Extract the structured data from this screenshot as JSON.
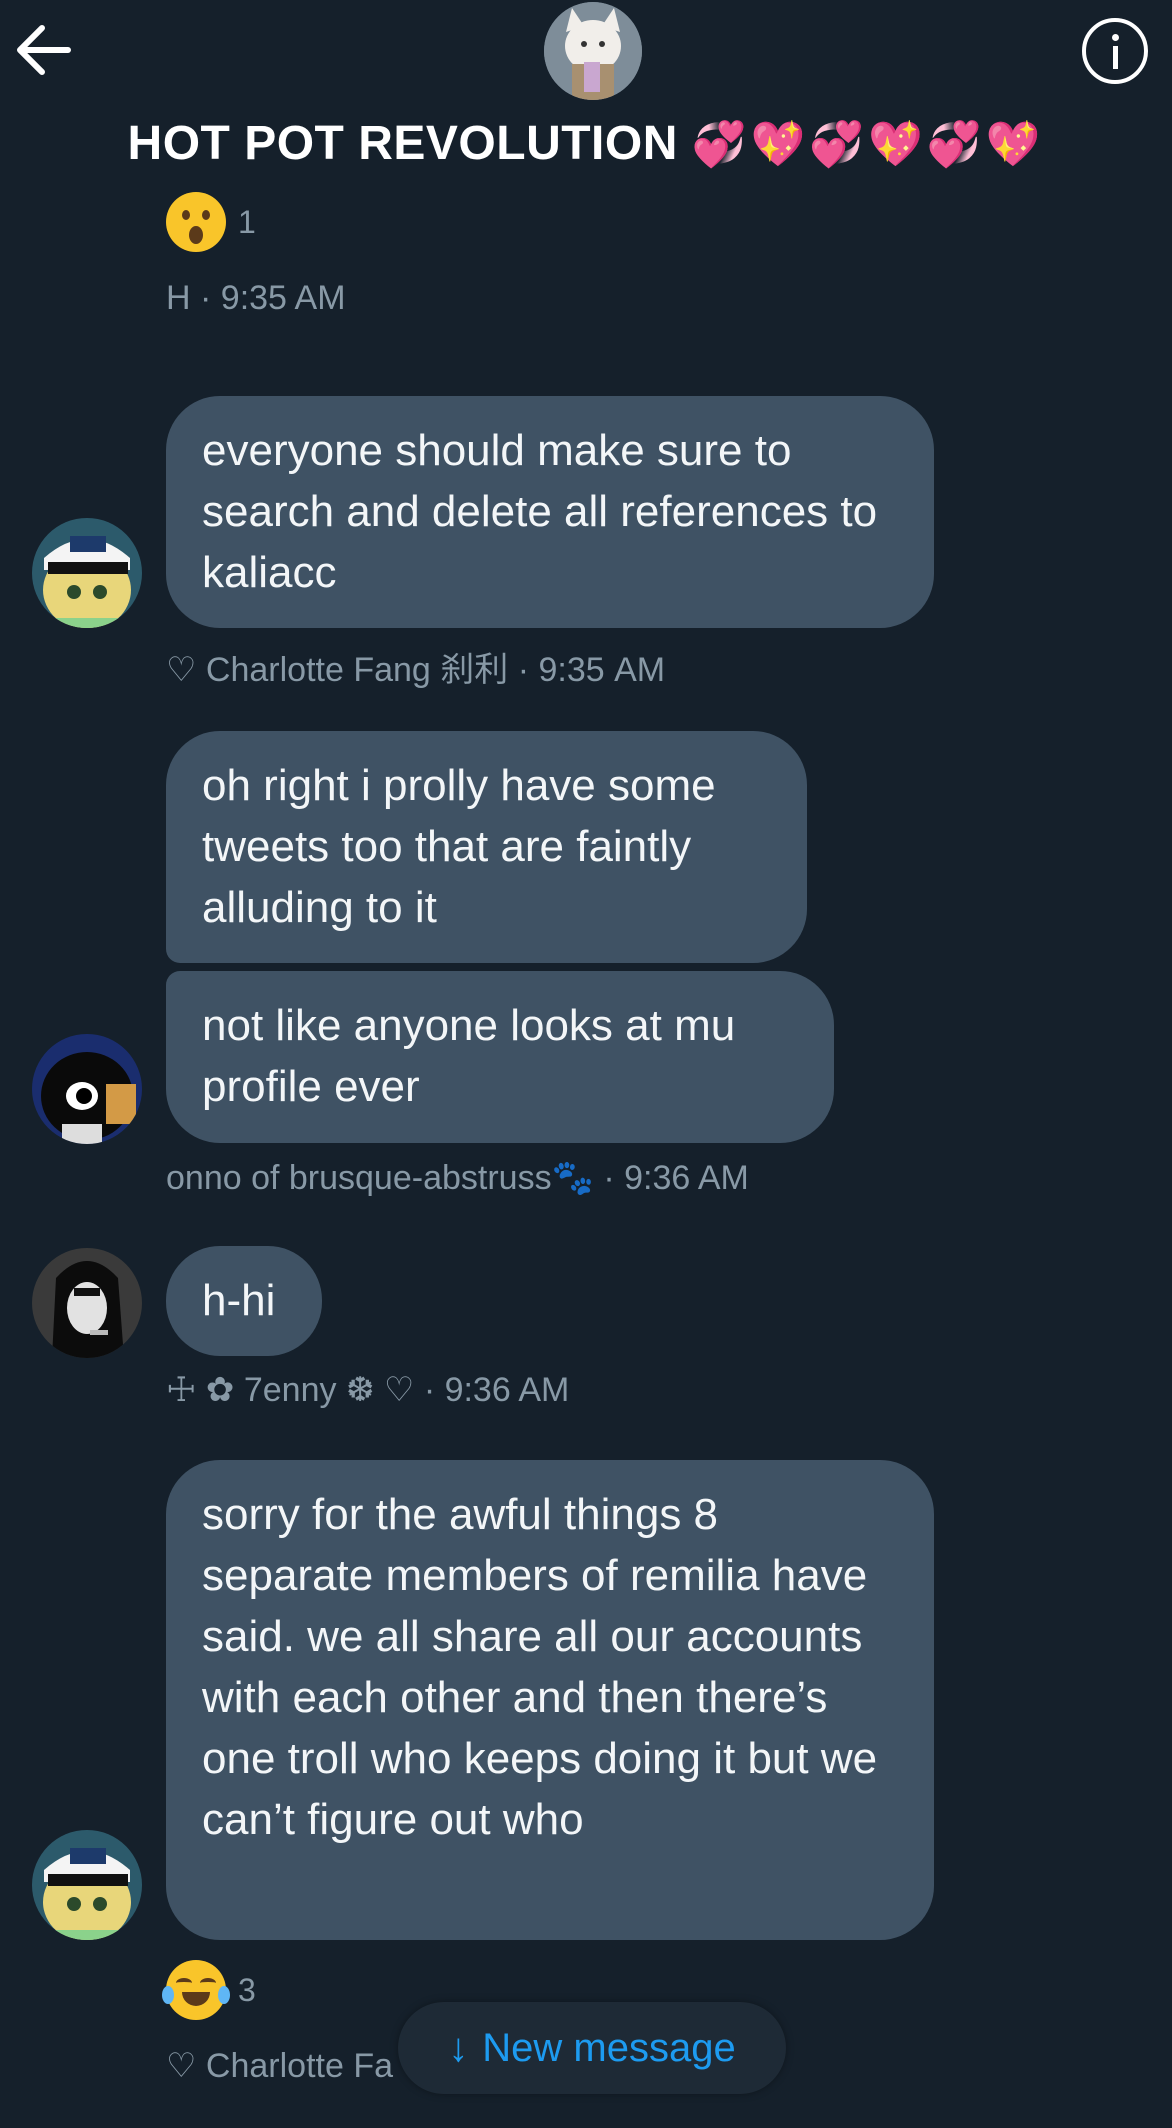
{
  "header": {
    "title": "HOT POT REVOLUTION",
    "title_emojis": "💞💖💞💖💞💖"
  },
  "top_reaction": {
    "emoji": "astonished-face",
    "count": "1"
  },
  "top_meta": {
    "sender": "H",
    "time": "· 9:35 AM"
  },
  "messages": [
    {
      "bubbles": [
        "everyone should make sure to search and delete all references to kaliacc"
      ],
      "sender": "♡ Charlotte Fang 刹利",
      "time": "· 9:35 AM"
    },
    {
      "bubbles": [
        "oh right i prolly have some tweets too that are faintly alluding to it",
        "not like anyone looks at mu profile ever"
      ],
      "sender": "onno of brusque-abstruss🐾",
      "time": "· 9:36 AM"
    },
    {
      "bubbles": [
        "h-hi"
      ],
      "sender": "☩ ✿ 7enny ❆ ♡",
      "time": "· 9:36 AM"
    },
    {
      "bubbles": [
        "sorry for the awful things 8 separate members of remilia have said. we all share all our accounts with each other and then there’s one troll who keeps doing it but we can’t figure out who"
      ],
      "reaction": {
        "emoji": "face-with-tears-of-joy",
        "count": "3"
      },
      "sender": "♡ Charlotte Fa"
    }
  ],
  "new_message_label": "New message",
  "colors": {
    "background": "#15202b",
    "bubble": "#3f5264",
    "meta": "#8899a6",
    "accent": "#1d9bf0"
  }
}
